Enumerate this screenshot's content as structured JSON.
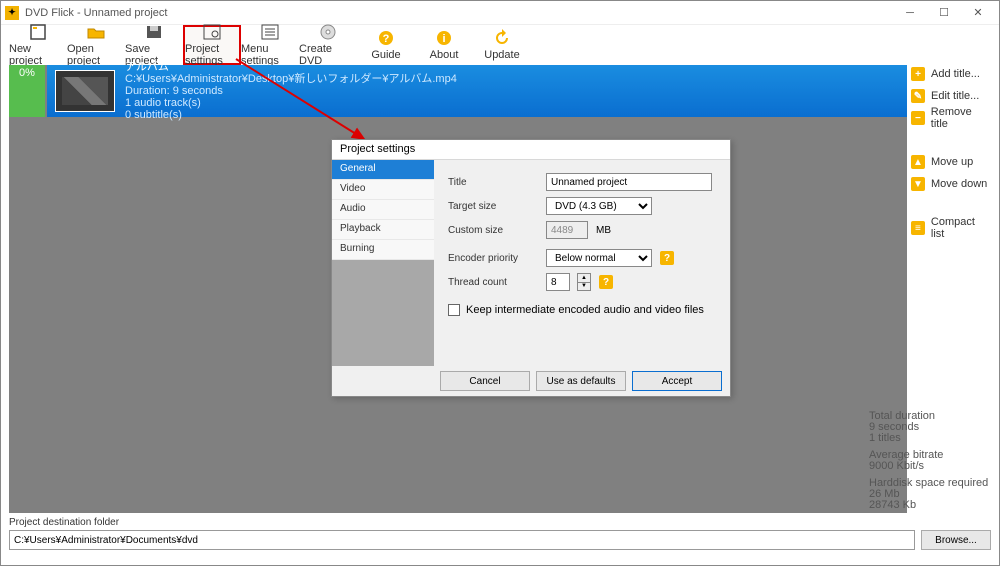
{
  "window": {
    "title": "DVD Flick - Unnamed project"
  },
  "toolbar": [
    {
      "id": "new-project",
      "label": "New project"
    },
    {
      "id": "open-project",
      "label": "Open project"
    },
    {
      "id": "save-project",
      "label": "Save project"
    },
    {
      "id": "project-settings",
      "label": "Project settings"
    },
    {
      "id": "menu-settings",
      "label": "Menu settings"
    },
    {
      "id": "create-dvd",
      "label": "Create DVD"
    },
    {
      "id": "guide",
      "label": "Guide"
    },
    {
      "id": "about",
      "label": "About"
    },
    {
      "id": "update",
      "label": "Update"
    }
  ],
  "progress": {
    "percent": "0%"
  },
  "titleItem": {
    "name": "アルバム",
    "path": "C:¥Users¥Administrator¥Desktop¥新しいフォルダー¥アルバム.mp4",
    "duration": "Duration: 9 seconds",
    "audio": "1 audio track(s)",
    "subs": "0 subtitle(s)"
  },
  "sideButtons": {
    "addTitle": "Add title...",
    "editTitle": "Edit title...",
    "removeTitle": "Remove title",
    "moveUp": "Move up",
    "moveDown": "Move down",
    "compactList": "Compact list"
  },
  "stats": {
    "l1": "Total duration",
    "v1": "9 seconds",
    "v1b": "1 titles",
    "l2": "Average bitrate",
    "v2": "9000 Kbit/s",
    "l3": "Harddisk space required",
    "v3": "26 Mb",
    "v3b": "28743 Kb"
  },
  "destination": {
    "label": "Project destination folder",
    "value": "C:¥Users¥Administrator¥Documents¥dvd",
    "browse": "Browse..."
  },
  "dialog": {
    "title": "Project settings",
    "tabs": [
      "General",
      "Video",
      "Audio",
      "Playback",
      "Burning"
    ],
    "activeTab": 0,
    "fields": {
      "titleLabel": "Title",
      "titleValue": "Unnamed project",
      "targetLabel": "Target size",
      "targetValue": "DVD (4.3 GB)",
      "customLabel": "Custom size",
      "customValue": "4489",
      "customUnit": "MB",
      "encoderLabel": "Encoder priority",
      "encoderValue": "Below normal",
      "threadLabel": "Thread count",
      "threadValue": "8",
      "keepFiles": "Keep intermediate encoded audio and video files"
    },
    "buttons": {
      "cancel": "Cancel",
      "defaults": "Use as defaults",
      "accept": "Accept"
    }
  }
}
